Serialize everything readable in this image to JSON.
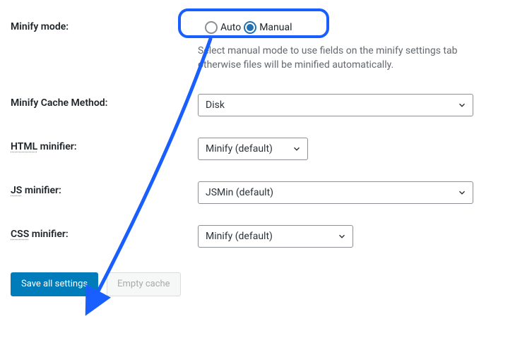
{
  "fields": {
    "minify_mode": {
      "label": "Minify mode:",
      "options": {
        "auto": "Auto",
        "manual": "Manual"
      },
      "selected": "manual",
      "description": "Select manual mode to use fields on the minify settings tab otherwise files will be minified automatically."
    },
    "cache_method": {
      "label": "Minify Cache Method:",
      "value": "Disk"
    },
    "html_minifier": {
      "label_abbr": "HTML",
      "label_rest": " minifier:",
      "value": "Minify (default)"
    },
    "js_minifier": {
      "label_abbr": "JS",
      "label_rest": " minifier:",
      "value": "JSMin (default)"
    },
    "css_minifier": {
      "label_abbr": "CSS",
      "label_rest": " minifier:",
      "value": "Minify (default)"
    }
  },
  "buttons": {
    "save": "Save all settings",
    "empty_cache": "Empty cache"
  },
  "annotation": {
    "highlight_color": "#195eff"
  }
}
